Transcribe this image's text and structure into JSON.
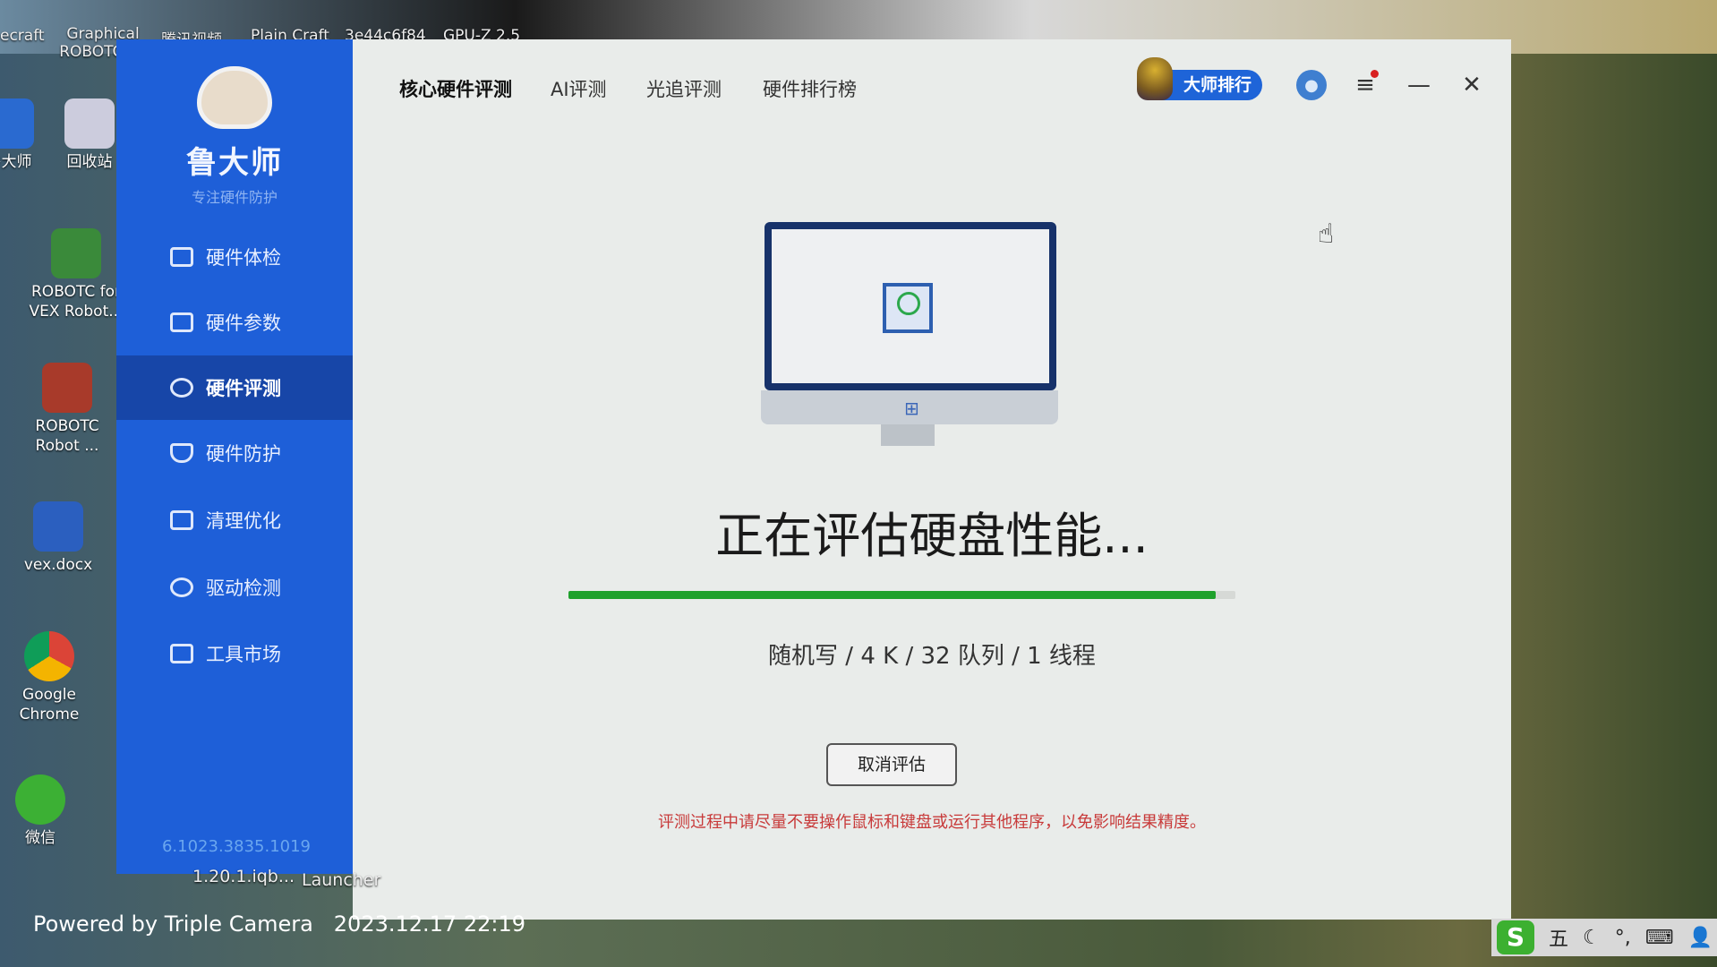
{
  "desktop": {
    "top_labels": [
      "ecraft",
      "Graphical ROBOTC f...",
      "腾讯视频",
      "Plain Craft",
      "3e44c6f84",
      "GPU-Z 2.5"
    ],
    "icons": [
      {
        "label": "鲁大师"
      },
      {
        "label": "回收站"
      },
      {
        "label": "ROBOTC for VEX Robot..."
      },
      {
        "label": "ROBOTC Robot ..."
      },
      {
        "label": "vex.docx"
      },
      {
        "label": "Google Chrome"
      },
      {
        "label": "微信"
      }
    ],
    "below_labels": [
      "1.20.1.iqb...",
      "Launcher"
    ]
  },
  "app": {
    "logo_name": "鲁大师",
    "logo_slogan": "专注硬件防护",
    "nav": [
      {
        "label": "硬件体检"
      },
      {
        "label": "硬件参数"
      },
      {
        "label": "硬件评测",
        "active": true
      },
      {
        "label": "硬件防护"
      },
      {
        "label": "清理优化"
      },
      {
        "label": "驱动检测"
      },
      {
        "label": "工具市场"
      }
    ],
    "version": "6.1023.3835.1019",
    "tabs": [
      {
        "label": "核心硬件评测",
        "active": true
      },
      {
        "label": "AI评测"
      },
      {
        "label": "光追评测"
      },
      {
        "label": "硬件排行榜"
      }
    ],
    "rank_button": "大师排行",
    "status_title": "正在评估硬盘性能...",
    "progress_percent": 97,
    "progress_color": "#1fa12c",
    "test_detail": "随机写 / 4 K / 32 队列 / 1 线程",
    "cancel_button": "取消评估",
    "warning": "评测过程中请尽量不要操作鼠标和键盘或运行其他程序，以免影响结果精度。",
    "accent": "#1e5fd8"
  },
  "photo": {
    "watermark": "Powered by Triple Camera",
    "datetime": "2023.12.17 22:19"
  },
  "tray": {
    "ime": "S",
    "mode": "五"
  }
}
